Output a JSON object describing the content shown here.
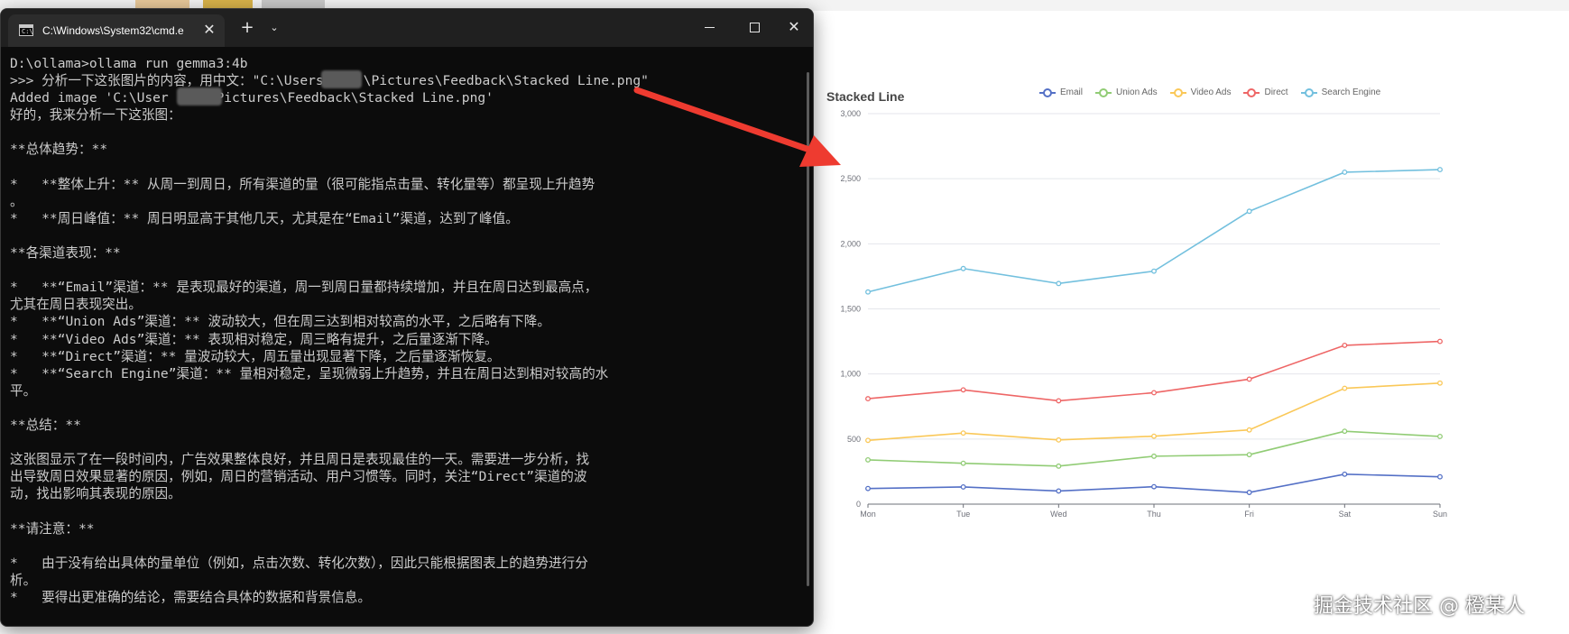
{
  "terminal": {
    "tab_title": "C:\\Windows\\System32\\cmd.e",
    "tab_icon_text": "C:\\",
    "close_tab_glyph": "✕",
    "new_tab_glyph": "+",
    "tab_menu_glyph": "⌄",
    "close_window_glyph": "✕",
    "lines": [
      "D:\\ollama>ollama run gemma3:4b",
      ">>> 分析一下这张图片的内容，用中文：\"C:\\Users\\    \\Pictures\\Feedback\\Stacked Line.png\"",
      "Added image 'C:\\User      Pictures\\Feedback\\Stacked Line.png'",
      "好的，我来分析一下这张图：",
      "",
      "**总体趋势：**",
      "",
      "*   **整体上升：** 从周一到周日，所有渠道的量（很可能指点击量、转化量等）都呈现上升趋势",
      "。",
      "*   **周日峰值：** 周日明显高于其他几天，尤其是在“Email”渠道，达到了峰值。",
      "",
      "**各渠道表现：**",
      "",
      "*   **“Email”渠道：** 是表现最好的渠道，周一到周日量都持续增加，并且在周日达到最高点，",
      "尤其在周日表现突出。",
      "*   **“Union Ads”渠道：** 波动较大，但在周三达到相对较高的水平，之后略有下降。",
      "*   **“Video Ads”渠道：** 表现相对稳定，周三略有提升，之后量逐渐下降。",
      "*   **“Direct”渠道：** 量波动较大，周五量出现显著下降，之后量逐渐恢复。",
      "*   **“Search Engine”渠道：** 量相对稳定，呈现微弱上升趋势，并且在周日达到相对较高的水",
      "平。",
      "",
      "**总结：**",
      "",
      "这张图显示了在一段时间内，广告效果整体良好，并且周日是表现最佳的一天。需要进一步分析，找",
      "出导致周日效果显著的原因，例如，周日的营销活动、用户习惯等。同时，关注“Direct”渠道的波",
      "动，找出影响其表现的原因。",
      "",
      "**请注意：**",
      "",
      "*   由于没有给出具体的量单位（例如，点击次数、转化次数），因此只能根据图表上的趋势进行分",
      "析。",
      "*   要得出更准确的结论，需要结合具体的数据和背景信息。"
    ]
  },
  "chart_data": {
    "type": "line",
    "title": "Stacked Line",
    "categories": [
      "Mon",
      "Tue",
      "Wed",
      "Thu",
      "Fri",
      "Sat",
      "Sun"
    ],
    "y_ticks": [
      "0",
      "500",
      "1,000",
      "1,500",
      "2,000",
      "2,500",
      "3,000"
    ],
    "ylim": [
      0,
      3000
    ],
    "grid": true,
    "legend_position": "top",
    "series": [
      {
        "name": "Email",
        "color": "#5470c6",
        "values": [
          120,
          132,
          101,
          134,
          90,
          230,
          210
        ]
      },
      {
        "name": "Union Ads",
        "color": "#91cc75",
        "values": [
          340,
          314,
          292,
          368,
          380,
          560,
          520
        ]
      },
      {
        "name": "Video Ads",
        "color": "#fac858",
        "values": [
          490,
          546,
          493,
          522,
          570,
          890,
          930
        ]
      },
      {
        "name": "Direct",
        "color": "#ee6666",
        "values": [
          810,
          878,
          794,
          856,
          960,
          1220,
          1250
        ]
      },
      {
        "name": "Search Engine",
        "color": "#73c0de",
        "values": [
          1630,
          1810,
          1695,
          1790,
          2250,
          2550,
          2570
        ]
      }
    ]
  },
  "watermark": "掘金技术社区 @ 橙某人"
}
